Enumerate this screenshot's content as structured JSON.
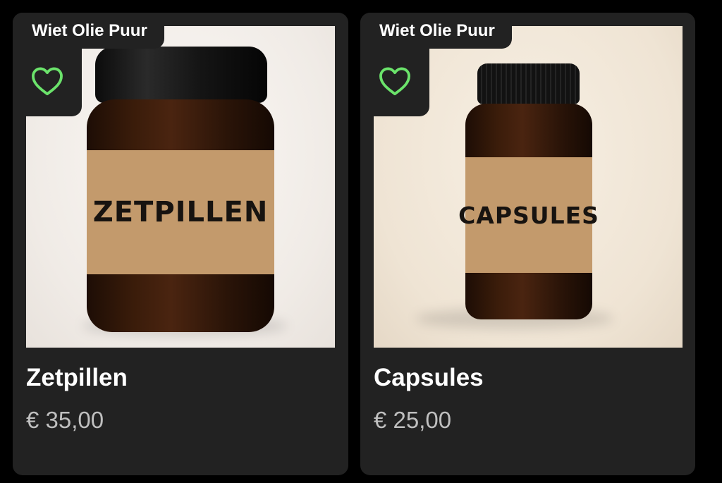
{
  "products": [
    {
      "brand": "Wiet Olie Puur",
      "jar_label": "ZETPILLEN",
      "title": "Zetpillen",
      "price": "€ 35,00",
      "favorite_icon": "heart-icon"
    },
    {
      "brand": "Wiet Olie Puur",
      "jar_label": "CAPSULES",
      "title": "Capsules",
      "price": "€ 25,00",
      "favorite_icon": "heart-icon"
    }
  ],
  "colors": {
    "background": "#000000",
    "card": "#222222",
    "heart_outline": "#6be36b",
    "title": "#ffffff",
    "price": "#bfbfbf",
    "label_kraft": "#c39a6c"
  }
}
